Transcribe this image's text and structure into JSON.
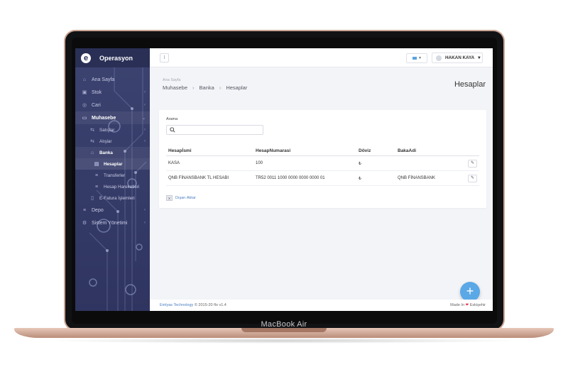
{
  "device": {
    "label": "MacBook Air"
  },
  "sidebar": {
    "brand": "Operasyon",
    "items": [
      {
        "label": "Ana Sayfa",
        "icon": "home-icon"
      },
      {
        "label": "Stok",
        "icon": "box-icon"
      },
      {
        "label": "Cari",
        "icon": "user-circle-icon"
      },
      {
        "label": "Muhasebe",
        "icon": "money-icon"
      },
      {
        "label": "Satışlar",
        "icon": "arrow-icon"
      },
      {
        "label": "Alışlar",
        "icon": "arrow-icon"
      },
      {
        "label": "Banka",
        "icon": "bank-icon"
      },
      {
        "label": "Hesaplar",
        "icon": "card-icon"
      },
      {
        "label": "Transferler",
        "icon": "list-icon"
      },
      {
        "label": "Hesap Hareketleri",
        "icon": "list-icon"
      },
      {
        "label": "E-Fatura İşlemleri",
        "icon": "document-icon"
      },
      {
        "label": "Depo",
        "icon": "list-icon"
      },
      {
        "label": "Sistem Yönetimi",
        "icon": "gear-icon"
      }
    ]
  },
  "topbar": {
    "menu_icon": "⁝",
    "user_name": "HAKAN KAYA"
  },
  "page": {
    "breadcrumb_small": "Ana Sayfa",
    "breadcrumbs": [
      "Muhasebe",
      "Banka",
      "Hesaplar"
    ],
    "title": "Hesaplar"
  },
  "search": {
    "label": "Arama",
    "value": ""
  },
  "table": {
    "headers": [
      "Hesapİsmi",
      "HesapNumarasi",
      "Döviz",
      "BakaAdi",
      ""
    ],
    "rows": [
      {
        "name": "KASA",
        "number": "100",
        "currency": "₺",
        "bank": ""
      },
      {
        "name": "QNB FİNANSBANK TL HESABI",
        "number": "TR52 0011 1000 0000 0000 0000 01",
        "currency": "₺",
        "bank": "QNB FİNANSBANK"
      }
    ]
  },
  "export": {
    "label": "Dışarı Aktar"
  },
  "footer": {
    "company": "Emlyas Technology",
    "copyright": "© 2015-20 flo v1.4",
    "made_in": "Made In",
    "city": "Eskişehir"
  },
  "fab": {
    "label": "+"
  }
}
